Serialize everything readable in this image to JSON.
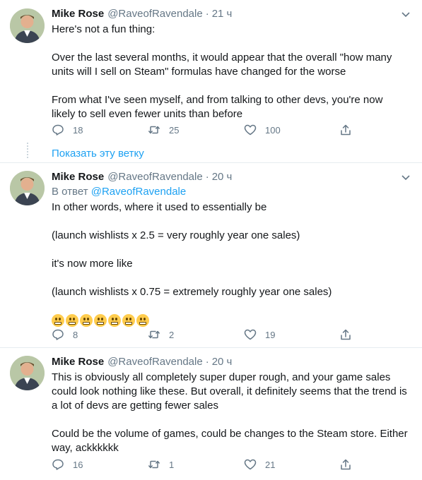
{
  "tweets": [
    {
      "name": "Mike Rose",
      "handle": "@RaveofRavendale",
      "sep": "·",
      "time": "21 ч",
      "reply_prefix": "",
      "reply_mention": "",
      "paragraphs": [
        "Here's not a fun thing:",
        "Over the last several months, it would appear that the overall \"how many units will I sell on Steam\" formulas have changed for the worse",
        "From what I've seen myself, and from talking to other devs, you're now likely to sell even fewer units than before"
      ],
      "replies": "18",
      "retweets": "25",
      "likes": "100"
    },
    {
      "name": "Mike Rose",
      "handle": "@RaveofRavendale",
      "sep": "·",
      "time": "20 ч",
      "reply_prefix": "В ответ ",
      "reply_mention": "@RaveofRavendale",
      "paragraphs": [
        "In other words, where it used to essentially be",
        "(launch wishlists x 2.5 = very roughly year one sales)",
        "it's now more like",
        "(launch wishlists x 0.75 = extremely roughly year one sales)"
      ],
      "emoji_count": 7,
      "replies": "8",
      "retweets": "2",
      "likes": "19"
    },
    {
      "name": "Mike Rose",
      "handle": "@RaveofRavendale",
      "sep": "·",
      "time": "20 ч",
      "reply_prefix": "",
      "reply_mention": "",
      "paragraphs": [
        "This is obviously all completely super duper rough, and your game sales could look nothing like these. But overall, it definitely seems that the trend is a lot of devs are getting fewer sales",
        "Could be the volume of games, could be changes to the Steam store. Either way, ackkkkkk"
      ],
      "replies": "16",
      "retweets": "1",
      "likes": "21"
    }
  ],
  "show_thread": "Показать эту ветку",
  "icons": {
    "reply": "reply-icon",
    "retweet": "retweet-icon",
    "like": "like-icon",
    "share": "share-icon",
    "caret": "chevron-down-icon",
    "emoji": "grimacing-face-emoji"
  },
  "colors": {
    "text": "#14171a",
    "muted": "#657786",
    "link": "#1da1f2",
    "divider": "#e6ecf0",
    "emoji": "#ffcc4d"
  }
}
